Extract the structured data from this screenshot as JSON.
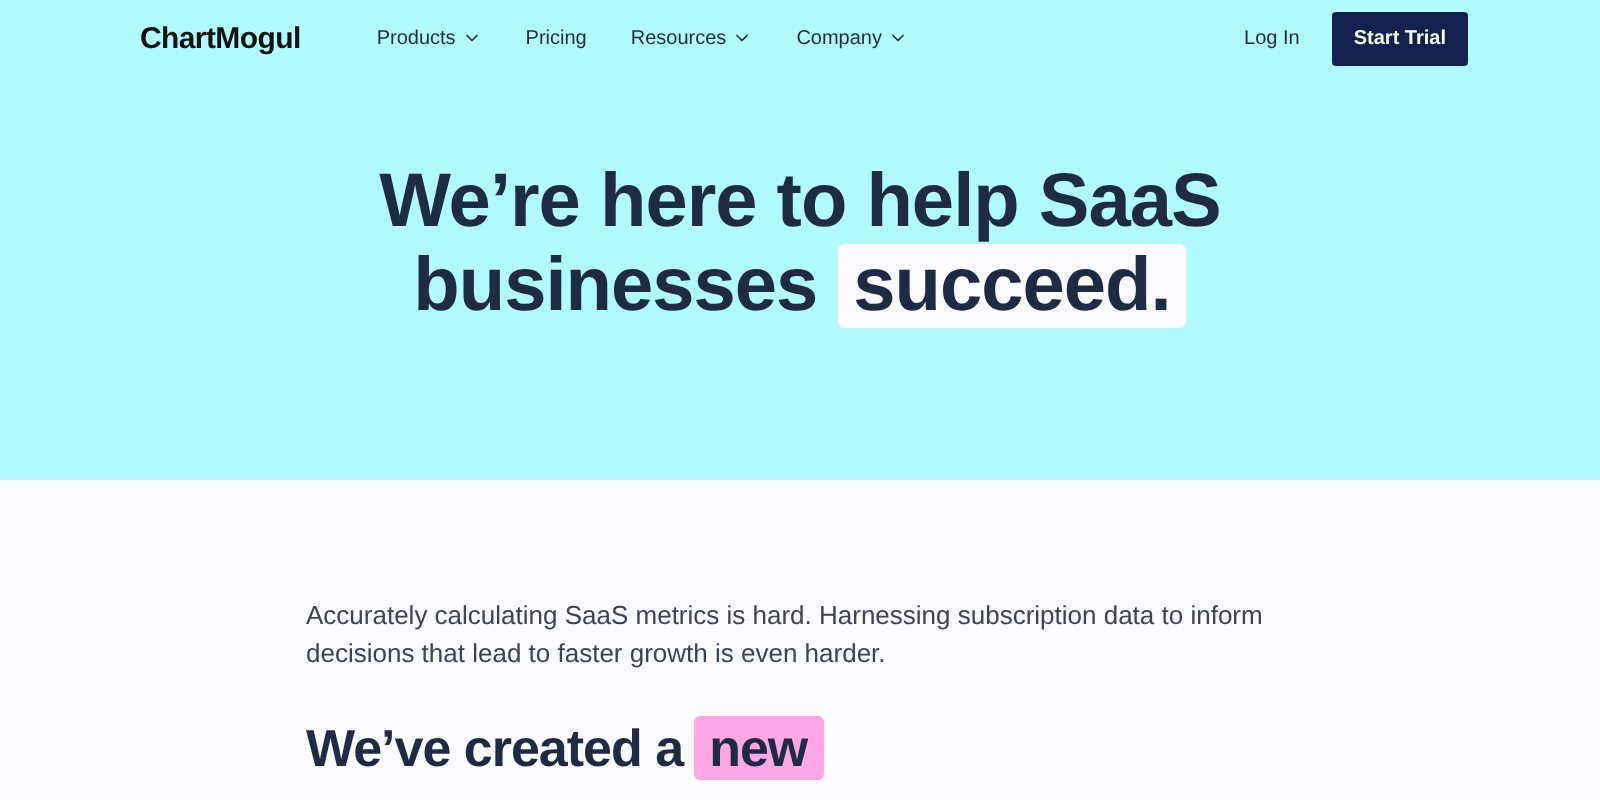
{
  "nav": {
    "logo": "ChartMogul",
    "items": [
      {
        "label": "Products",
        "kind": "dropdown"
      },
      {
        "label": "Pricing",
        "kind": "link"
      },
      {
        "label": "Resources",
        "kind": "dropdown"
      },
      {
        "label": "Company",
        "kind": "dropdown"
      }
    ],
    "login": "Log In",
    "cta": "Start Trial"
  },
  "hero": {
    "title_lines": [
      [
        {
          "text": "We’re here to help SaaS",
          "highlighted": false
        }
      ],
      [
        {
          "text": "businesses",
          "highlighted": false
        },
        {
          "text": "succeed.",
          "highlighted": true,
          "color": "#fafaff"
        }
      ]
    ]
  },
  "intro": {
    "paragraph": "Accurately calculating SaaS metrics is hard. Harnessing subscription data to inform decisions that lead to faster growth is even harder.",
    "heading": [
      {
        "text": "We’ve created a",
        "highlighted": false
      },
      {
        "text": "new",
        "highlighted": true,
        "color": "#ffa6e6"
      }
    ]
  }
}
